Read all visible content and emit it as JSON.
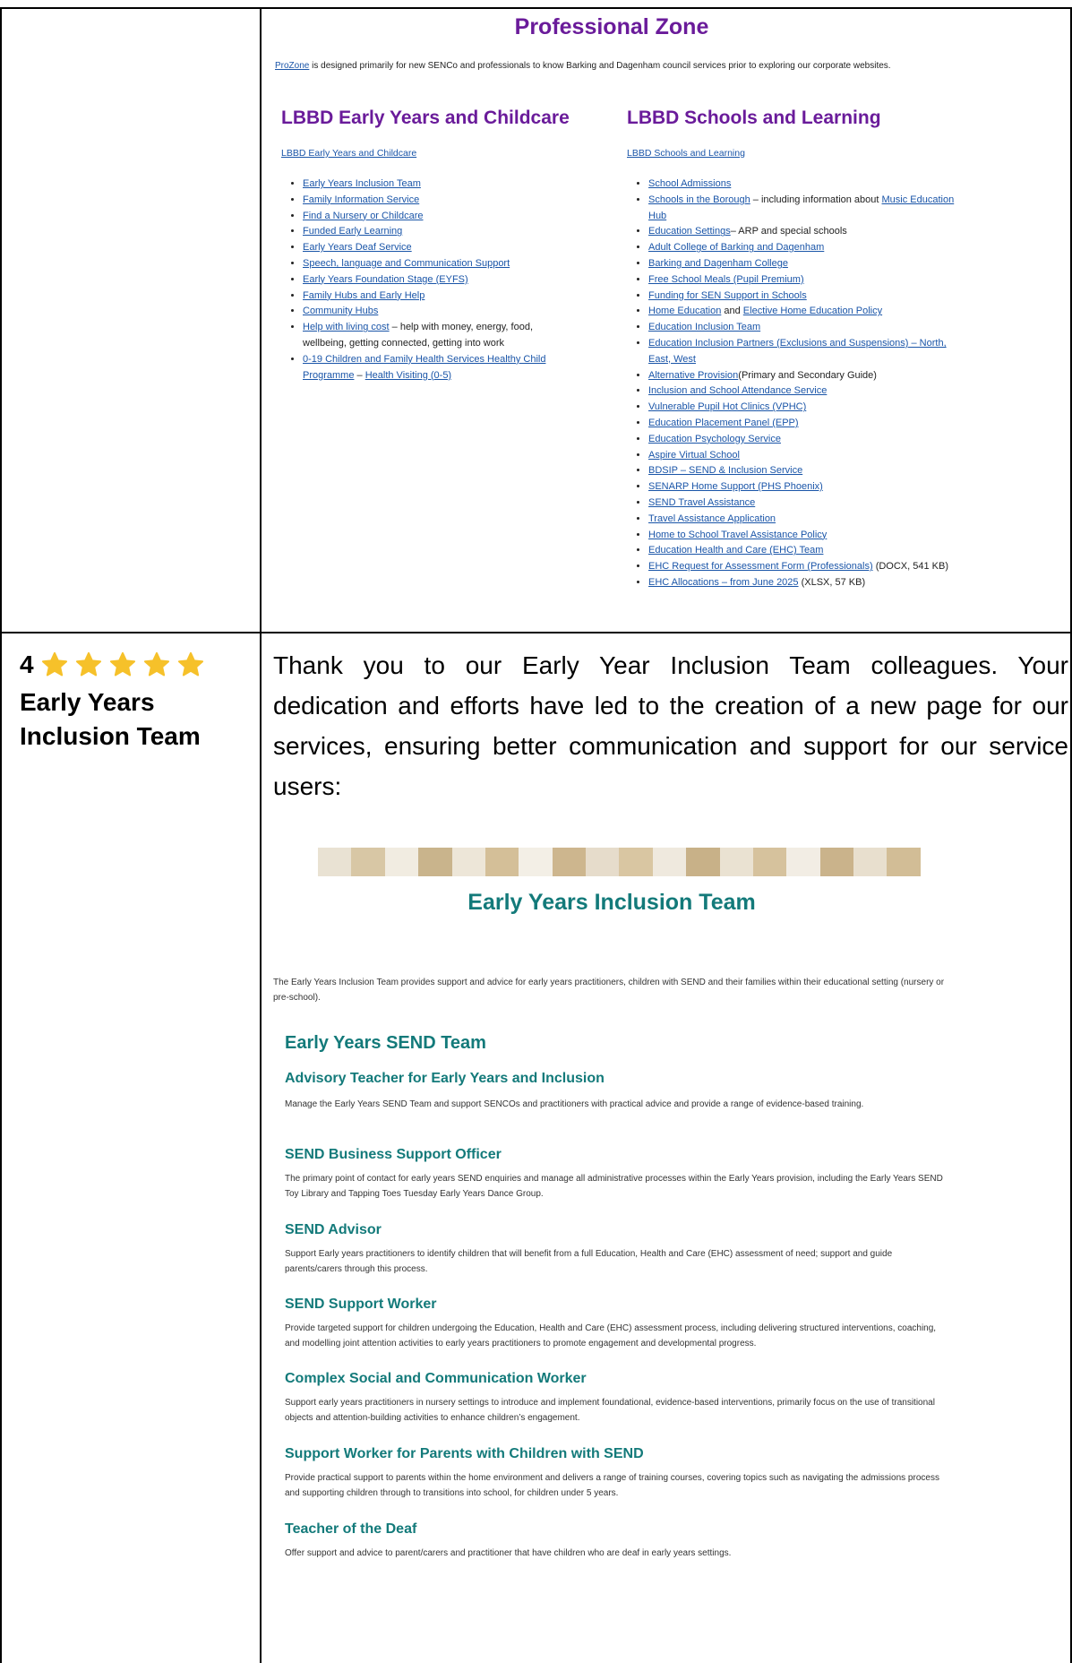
{
  "professional_zone": {
    "title": "Professional Zone",
    "intro_link": "ProZone",
    "intro_rest": " is designed primarily for new SENCo and professionals to know Barking and Dagenham council services prior to exploring our corporate websites.",
    "left_col": {
      "heading": "LBBD Early Years and Childcare",
      "sublink": "LBBD Early Years and Childcare",
      "items": [
        {
          "link": "Early Years Inclusion Team",
          "rest": ""
        },
        {
          "link": "Family Information Service",
          "rest": ""
        },
        {
          "link": "Find a Nursery or Childcare",
          "rest": ""
        },
        {
          "link": "Funded Early Learning",
          "rest": ""
        },
        {
          "link": "Early Years Deaf Service",
          "rest": ""
        },
        {
          "link": "Speech, language and Communication Support",
          "rest": ""
        },
        {
          "link": "Early Years Foundation Stage (EYFS)",
          "rest": ""
        },
        {
          "link": "Family Hubs and Early Help",
          "rest": ""
        },
        {
          "link": "Community Hubs",
          "rest": ""
        },
        {
          "link": "Help with living cost",
          "rest": " – help with money, energy, food, wellbeing, getting connected, getting into work"
        },
        {
          "link": "0-19 Children and Family Health Services Healthy Child Programme",
          "rest": " – ",
          "link2": "Health Visiting (0-5)"
        }
      ]
    },
    "right_col": {
      "heading": "LBBD Schools and Learning",
      "sublink": "LBBD Schools and Learning",
      "items": [
        {
          "link": "School Admissions",
          "rest": ""
        },
        {
          "link": "Schools in the Borough",
          "rest": " – including information about ",
          "link2": "Music Education Hub"
        },
        {
          "link": "Education Settings",
          "rest": "– ARP and special schools"
        },
        {
          "link": "Adult College of Barking and Dagenham",
          "rest": ""
        },
        {
          "link": "Barking and Dagenham College",
          "rest": ""
        },
        {
          "link": "Free School Meals (Pupil Premium)",
          "rest": ""
        },
        {
          "link": "Funding for SEN Support in Schools",
          "rest": ""
        },
        {
          "link": "Home Education",
          "rest": " and ",
          "link2": "Elective Home Education Policy"
        },
        {
          "link": "Education Inclusion Team",
          "rest": ""
        },
        {
          "link": "Education Inclusion Partners (Exclusions and Suspensions) – North, East, West",
          "rest": ""
        },
        {
          "link": "Alternative Provision",
          "rest": "(Primary and Secondary Guide)"
        },
        {
          "link": "Inclusion and School Attendance Service",
          "rest": ""
        },
        {
          "link": "Vulnerable Pupil Hot Clinics (VPHC)",
          "rest": ""
        },
        {
          "link": "Education Placement Panel (EPP)",
          "rest": ""
        },
        {
          "link": "Education Psychology Service",
          "rest": ""
        },
        {
          "link": "Aspire Virtual School",
          "rest": ""
        },
        {
          "link": "BDSIP – SEND & Inclusion Service",
          "rest": ""
        },
        {
          "link": "SENARP Home Support (PHS Phoenix)",
          "rest": ""
        },
        {
          "link": "SEND Travel Assistance",
          "rest": ""
        },
        {
          "link": "Travel Assistance Application",
          "rest": ""
        },
        {
          "link": "Home to School Travel Assistance Policy",
          "rest": ""
        },
        {
          "link": "Education Health and Care (EHC) Team",
          "rest": ""
        },
        {
          "link": "EHC Request for Assessment Form (Professionals)",
          "rest": " (DOCX, 541 KB)"
        },
        {
          "link": "EHC Allocations – from June 2025",
          "rest": " (XLSX, 57 KB)"
        }
      ]
    }
  },
  "row2": {
    "number": "4",
    "stars": 5,
    "title": "Early Years Inclusion Team",
    "thanks": "Thank you to our Early Year Inclusion Team colleagues. Your dedication and efforts have led to the creation of a new page for our services, ensuring better communication and support for our service users:"
  },
  "early_years": {
    "title": "Early Years Inclusion Team",
    "intro": "The Early Years Inclusion Team provides support and advice for early years practitioners, children with SEND and their families within their educational setting (nursery or pre-school).",
    "section_heading": "Early Years SEND Team",
    "roles": [
      {
        "title": "Advisory Teacher for Early Years and Inclusion",
        "desc": "Manage the Early Years SEND Team and support SENCOs and practitioners with practical advice and provide a range of evidence-based training."
      },
      {
        "title": "SEND Business Support Officer",
        "desc": "The primary point of contact for early years SEND enquiries and manage all administrative processes within the Early Years provision, including the Early Years SEND Toy Library and Tapping Toes Tuesday Early Years Dance Group."
      },
      {
        "title": "SEND Advisor",
        "desc": "Support Early years practitioners to identify children that will benefit from a full Education, Health and Care (EHC) assessment of need; support and guide parents/carers through this process."
      },
      {
        "title": "SEND Support Worker",
        "desc": "Provide targeted support for children undergoing the Education, Health and Care (EHC) assessment process, including delivering structured interventions, coaching, and modelling joint attention activities to early years practitioners to promote engagement and developmental progress."
      },
      {
        "title": "Complex Social and Communication Worker",
        "desc": "Support early years practitioners in nursery settings to introduce and implement foundational, evidence-based interventions, primarily focus on the use of transitional objects and attention-building activities to enhance children’s engagement."
      },
      {
        "title": "Support Worker for Parents with Children with SEND",
        "desc": "Provide practical support to parents within the home environment and delivers a range of training courses, covering topics such as navigating the admissions process and supporting children through to transitions into school, for children under 5 years."
      },
      {
        "title": "Teacher of the Deaf",
        "desc": "Offer support and advice to parent/carers and practitioner that have children who are deaf in early years settings."
      }
    ]
  },
  "colors": {
    "purple": "#6a1b9a",
    "teal": "#137a7a",
    "link": "#1a55a8",
    "star": "#f6c12a"
  }
}
